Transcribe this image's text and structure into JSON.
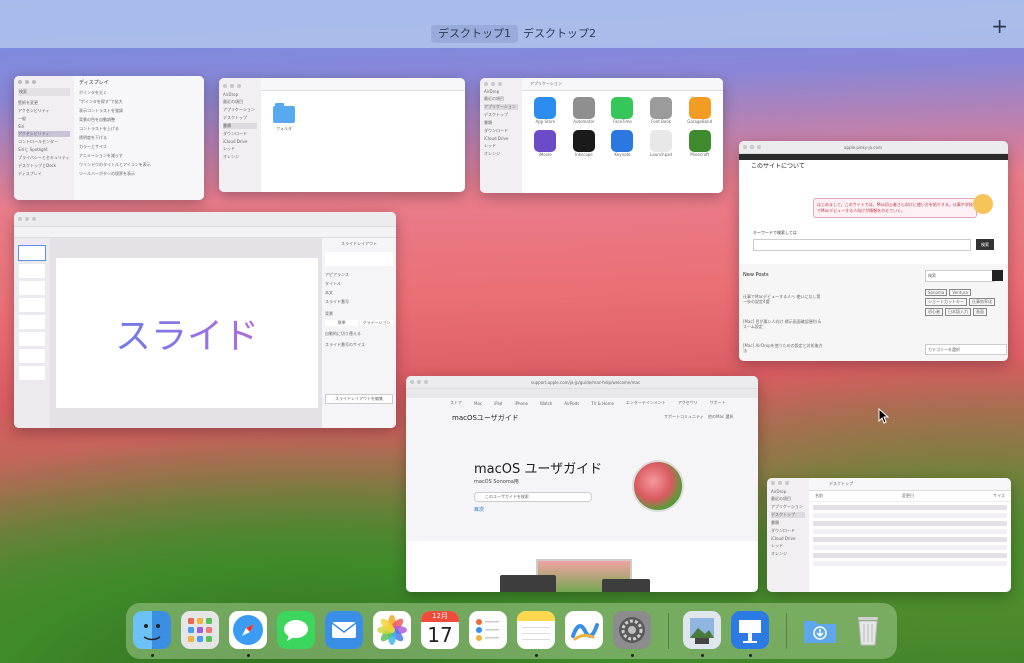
{
  "spaces": {
    "items": [
      "デスクトップ1",
      "デスクトップ2"
    ],
    "active_index": 0,
    "add_label": "+"
  },
  "settings_window": {
    "search_placeholder": "検索",
    "section_title": "ディスプレイ",
    "sidebar": [
      "壁紙を変更",
      "アクセシビリティ",
      "一般",
      "Siri",
      "アクセシビリティ",
      "コントロールセンター",
      "Siriと Spotlight",
      "プライバシーとセキュリティ",
      "デスクトップとDock",
      "ディスプレイ"
    ],
    "rows": [
      "ポインタを太く",
      "\"ポインタを探す\"で拡大",
      "表示コントラストを強調",
      "背景の色を自動調整",
      "コントラストを上げる",
      "透明度を下げる",
      "カラーとサイズ",
      "アニメーションを減らす",
      "ウインドウのタイトルとアイコンを表示",
      "ツールバーボタンの境界を表示"
    ]
  },
  "finder_window1": {
    "sidebar": [
      "AirDrop",
      "最近の項目",
      "アプリケーション",
      "デスクトップ",
      "書類",
      "ダウンロード",
      "iCloud Drive",
      "レッド",
      "オレンジ"
    ],
    "folder_label": "フォルダ"
  },
  "apps_window": {
    "title": "アプリケーション",
    "sidebar": [
      "AirDrop",
      "最近の項目",
      "アプリケーション",
      "デスクトップ",
      "書類",
      "ダウンロード",
      "iCloud Drive",
      "レッド",
      "オレンジ"
    ],
    "apps": [
      {
        "label": "App Store",
        "color": "#2d8cf0"
      },
      {
        "label": "Automator",
        "color": "#8f8f8f"
      },
      {
        "label": "FaceTime",
        "color": "#35c759"
      },
      {
        "label": "Font Book",
        "color": "#9b9b9b"
      },
      {
        "label": "GarageBand",
        "color": "#f29c23"
      },
      {
        "label": "iMovie",
        "color": "#6c4bc9"
      },
      {
        "label": "Inkscape",
        "color": "#1a1a1a"
      },
      {
        "label": "Keynote",
        "color": "#2b79e0"
      },
      {
        "label": "Launchpad",
        "color": "#e8e8e8"
      },
      {
        "label": "Minecraft",
        "color": "#3e8a2c"
      }
    ]
  },
  "keynote_window": {
    "slide_text": "スライド",
    "format_tabs": [
      "スライドレイアウト"
    ],
    "panel_items": [
      "アピアランス",
      "タイトル",
      "本文",
      "スライド番号",
      "背景",
      "標準",
      "グラデーション",
      "自動的に切り替える",
      "スライド番号のサイズ"
    ],
    "panel_button": "スライドレイアウトを編集"
  },
  "blog_window": {
    "url": "apple.pinky-ja.com",
    "heading": "このサイトについて",
    "intro": "はじめまして。このサイトでは、Mac初心者さん向けに使い方を紹介する。仕事や学校でMacデビューする人向けが情報をのせていく。",
    "search_label": "キーワードで検索しては",
    "search_button": "検索",
    "new_posts_title": "New Posts",
    "posts": [
      "仕事でMacデビューする人へ 使いになし第一歩の設定4選",
      "[Mac] 目が悪い人向け 標示画面確認便利 & ズーム設定",
      "[Mac] AirDropを使うための設定と対処後方法"
    ],
    "tags": [
      "Sonoma",
      "Ventura",
      "ショートカットキー",
      "仕事効率化",
      "初心者",
      "日本語入力",
      "画面"
    ],
    "category_select": "カテゴリーを選択",
    "side_search_placeholder": "検索"
  },
  "guide_window": {
    "url": "support.apple.com/ja-jp/guide/mac-help/welcome/mac",
    "nav": [
      "ストア",
      "Mac",
      "iPad",
      "iPhone",
      "Watch",
      "AirPods",
      "TV & Home",
      "エンターテインメント",
      "アクセサリ",
      "サポート"
    ],
    "brand": "macOSユーザガイド",
    "top_right": [
      "サポートコミュニティ",
      "他のMac 選択"
    ],
    "title": "macOS ユーザガイド",
    "subtitle": "macOS Sonoma用",
    "search_placeholder": "このユーザガイドを検索",
    "toc_link": "目次"
  },
  "finder_window2": {
    "title": "デスクトップ",
    "sidebar": [
      "AirDrop",
      "最近の項目",
      "アプリケーション",
      "デスクトップ",
      "書類",
      "ダウンロード",
      "iCloud Drive",
      "レッド",
      "オレンジ"
    ],
    "columns": [
      "名前",
      "変更日",
      "サイズ"
    ]
  },
  "dock": {
    "apps": [
      {
        "name": "finder-icon",
        "label": "Finder",
        "color": "#3aa2ee",
        "running": true
      },
      {
        "name": "launchpad-icon",
        "label": "Launchpad",
        "color": "#e5e5e5",
        "running": false
      },
      {
        "name": "safari-icon",
        "label": "Safari",
        "color": "#ffffff",
        "running": true
      },
      {
        "name": "messages-icon",
        "label": "メッセージ",
        "color": "#3bd65b",
        "running": false
      },
      {
        "name": "mail-icon",
        "label": "メール",
        "color": "#3a8ee6",
        "running": false
      },
      {
        "name": "photos-icon",
        "label": "写真",
        "color": "#ffffff",
        "running": false
      },
      {
        "name": "calendar-icon",
        "label": "カレンダー",
        "color": "#ffffff",
        "running": false
      },
      {
        "name": "reminders-icon",
        "label": "リマインダー",
        "color": "#ffffff",
        "running": false
      },
      {
        "name": "notes-icon",
        "label": "メモ",
        "color": "#ffd84d",
        "running": true
      },
      {
        "name": "freeform-icon",
        "label": "フリーボード",
        "color": "#ffffff",
        "running": false
      },
      {
        "name": "system-settings-icon",
        "label": "システム設定",
        "color": "#8c8c8c",
        "running": true
      },
      {
        "name": "preview-icon",
        "label": "プレビュー",
        "color": "#dfe6ee",
        "running": true
      },
      {
        "name": "keynote-icon",
        "label": "Keynote",
        "color": "#2c7be5",
        "running": true
      },
      {
        "name": "downloads-folder-icon",
        "label": "ダウンロード",
        "color": "#5ea7ea",
        "running": false
      },
      {
        "name": "trash-icon",
        "label": "ゴミ箱",
        "color": "#d9d9d9",
        "running": false
      }
    ],
    "calendar_month": "12月",
    "calendar_day": "17"
  }
}
